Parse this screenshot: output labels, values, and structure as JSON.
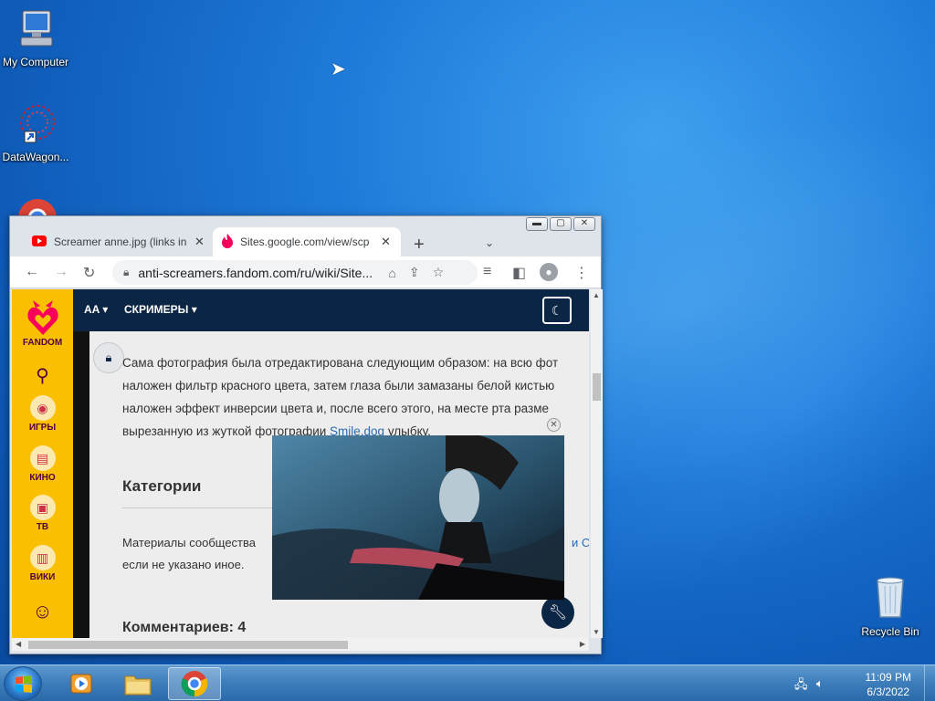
{
  "desktop": {
    "icons": [
      {
        "label": "My Computer"
      },
      {
        "label": "DataWagon..."
      },
      {
        "label": "Recycle Bin"
      }
    ]
  },
  "browser": {
    "tabs": [
      {
        "title": "Screamer anne.jpg (links in",
        "close": "✕"
      },
      {
        "title": "Sites.google.com/view/scp",
        "close": "✕"
      }
    ],
    "new_tab": "+",
    "address": "anti-screamers.fandom.com/ru/wiki/Site..."
  },
  "page": {
    "rail": {
      "brand": "FANDOM",
      "items": [
        "ИГРЫ",
        "КИНО",
        "ТВ",
        "ВИКИ"
      ]
    },
    "topnav": {
      "logo": "AA",
      "menu": "СКРИМЕРЫ"
    },
    "paragraph": {
      "line1": "Сама фотография была отредактирована следующим образом: на всю фот",
      "line2": "наложен фильтр красного цвета, затем глаза были замазаны белой кистью",
      "line3": "наложен эффект инверсии цвета и, после всего этого, на месте рта разме",
      "line4_pre": "вырезанную из жуткой фотографии ",
      "line4_link": "Smile.dog",
      "line4_post": " улыбку."
    },
    "categories_heading": "Категории",
    "license": {
      "line1": "Материалы сообщества",
      "line1_link": "и С",
      "line2": "если не указано иное."
    },
    "comments_heading": "Комментариев: 4"
  },
  "taskbar": {
    "time": "11:09 PM",
    "date": "6/3/2022"
  },
  "colors": {
    "fandom_yellow": "#fac000",
    "fandom_nav": "#0b2545",
    "link": "#2a6ab3"
  }
}
